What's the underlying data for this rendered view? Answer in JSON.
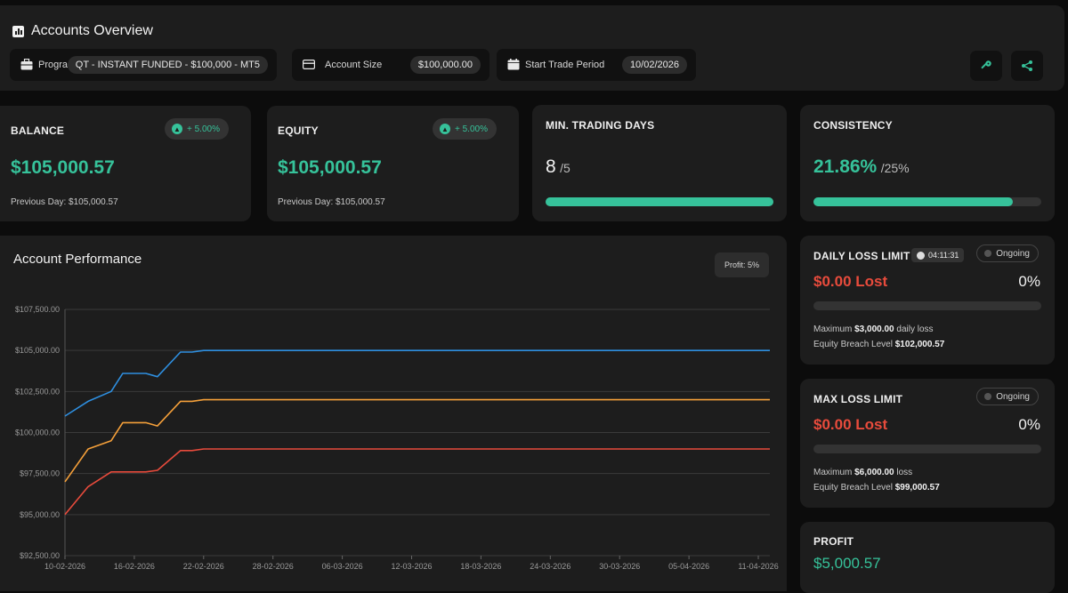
{
  "header": {
    "title": "Accounts Overview",
    "program_label": "Program",
    "program_value": "QT - INSTANT FUNDED - $100,000 - MT5",
    "account_size_label": "Account Size",
    "account_size_value": "$100,000.00",
    "start_label": "Start Trade Period",
    "start_value": "10/02/2026"
  },
  "balance": {
    "label": "BALANCE",
    "badge": "+ 5.00%",
    "value": "$105,000.57",
    "previous": "Previous Day: $105,000.57"
  },
  "equity": {
    "label": "EQUITY",
    "badge": "+ 5.00%",
    "value": "$105,000.57",
    "previous": "Previous Day: $105,000.57"
  },
  "min_days": {
    "label": "MIN. TRADING DAYS",
    "value": "8",
    "target": "/5",
    "progress": 1.0
  },
  "consistency": {
    "label": "CONSISTENCY",
    "value": "21.86%",
    "target": "/25%",
    "progress": 0.874
  },
  "performance": {
    "title": "Account Performance",
    "profit_tag": "Profit: 5%"
  },
  "daily_loss": {
    "label": "DAILY LOSS LIMIT",
    "timer": "04:11:31",
    "status": "Ongoing",
    "value": "$0.00 Lost",
    "pct": "0%",
    "progress": 0,
    "max_prefix": "Maximum ",
    "max_value": "$3,000.00",
    "max_suffix": " daily loss",
    "breach_prefix": "Equity Breach Level ",
    "breach_value": "$102,000.57"
  },
  "max_loss": {
    "label": "MAX LOSS LIMIT",
    "status": "Ongoing",
    "value": "$0.00 Lost",
    "pct": "0%",
    "progress": 0,
    "max_prefix": "Maximum ",
    "max_value": "$6,000.00",
    "max_suffix": " loss",
    "breach_prefix": "Equity Breach Level ",
    "breach_value": "$99,000.57"
  },
  "profit": {
    "label": "PROFIT",
    "value": "$5,000.57"
  },
  "colors": {
    "accent": "#36c29a",
    "loss": "#e84b3c",
    "series_blue": "#2e8fe0",
    "series_orange": "#f5a03a",
    "series_red": "#e84b3c"
  },
  "chart_data": {
    "type": "line",
    "x": [
      "10-02-2026",
      "12-02-2026",
      "14-02-2026",
      "15-02-2026",
      "17-02-2026",
      "18-02-2026",
      "20-02-2026",
      "21-02-2026",
      "22-02-2026",
      "12-04-2026"
    ],
    "xticks": [
      "10-02-2026",
      "16-02-2026",
      "22-02-2026",
      "28-02-2026",
      "06-03-2026",
      "12-03-2026",
      "18-03-2026",
      "24-03-2026",
      "30-03-2026",
      "05-04-2026",
      "11-04-2026"
    ],
    "yticks": [
      "$92,500.00",
      "$95,000.00",
      "$97,500.00",
      "$100,000.00",
      "$102,500.00",
      "$105,000.00",
      "$107,500.00"
    ],
    "ylim": [
      92500,
      107500
    ],
    "series": [
      {
        "color": "#2e8fe0",
        "values": [
          101000,
          101900,
          102500,
          103600,
          103600,
          103400,
          104900,
          104900,
          105000,
          105000
        ]
      },
      {
        "color": "#f5a03a",
        "values": [
          97000,
          99000,
          99500,
          100600,
          100600,
          100400,
          101900,
          101900,
          102000,
          102000
        ]
      },
      {
        "color": "#e84b3c",
        "values": [
          95000,
          96700,
          97600,
          97600,
          97600,
          97700,
          98900,
          98900,
          99000,
          99000
        ]
      }
    ]
  }
}
